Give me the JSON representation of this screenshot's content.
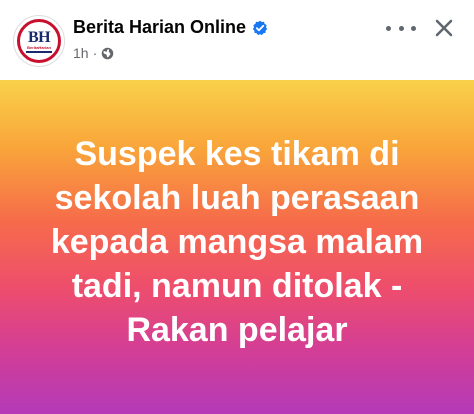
{
  "page": {
    "name": "Berita Harian Online",
    "avatar_text": "BH",
    "avatar_subtext": "BeritaHarian",
    "time": "1h",
    "separator": "·",
    "privacy_icon": "globe-icon",
    "verified_icon": "verified-badge-icon",
    "verified_color": "#1877f2"
  },
  "actions": {
    "more_icon": "more-horizontal-icon",
    "close_icon": "close-icon"
  },
  "post": {
    "text": "Suspek kes tikam di sekolah luah perasaan kepada mangsa malam tadi, namun ditolak - Rakan pelajar",
    "gradient_colors": [
      "#f9d14a",
      "#f9a63a",
      "#f66c4a",
      "#ee4e6c",
      "#d43e94",
      "#b43ab8"
    ]
  }
}
